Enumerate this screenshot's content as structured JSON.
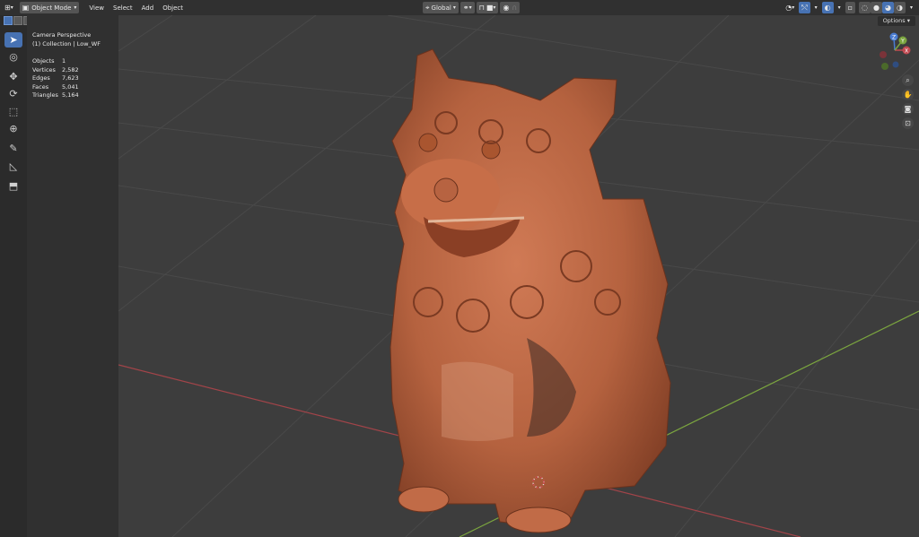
{
  "header": {
    "editor_type_icon": "3d-viewport-icon",
    "mode": "Object Mode",
    "menus": [
      "View",
      "Select",
      "Add",
      "Object"
    ],
    "transform_orientation": "Global",
    "options_label": "Options"
  },
  "overlay": {
    "view_name": "Camera Perspective",
    "collection": "(1) Collection | Low_WF",
    "stats": [
      {
        "label": "Objects",
        "value": "1"
      },
      {
        "label": "Vertices",
        "value": "2,582"
      },
      {
        "label": "Edges",
        "value": "7,623"
      },
      {
        "label": "Faces",
        "value": "5,041"
      },
      {
        "label": "Triangles",
        "value": "5,164"
      }
    ]
  },
  "gizmo": {
    "x_label": "X",
    "y_label": "Y",
    "z_label": "Z"
  },
  "colors": {
    "header_bg": "#303030",
    "toolbar_bg": "#2b2b2b",
    "viewport_bg": "#3d3d3d",
    "grid": "#4a4a4a",
    "axis_x": "#a24449",
    "axis_y": "#7ba53f",
    "active_tool": "#4772b3",
    "statue": "#b5623f"
  },
  "tools": [
    "select-box-icon",
    "cursor-icon",
    "move-icon",
    "rotate-icon",
    "scale-icon",
    "transform-icon",
    "annotate-icon",
    "measure-icon",
    "add-cube-icon"
  ]
}
